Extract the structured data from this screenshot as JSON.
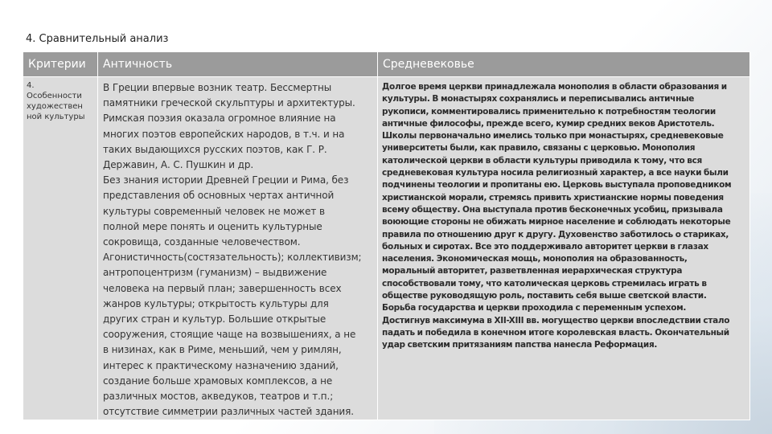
{
  "title": "4. Сравнительный анализ",
  "table": {
    "headers": [
      "Критерии",
      "Античность",
      "Средневековье"
    ],
    "criterion_lines": [
      "4.",
      "Особенности",
      "художествен",
      "ной культуры"
    ],
    "antiquity_lines": [
      "В Греции впервые возник театр. Бессмертны",
      "памятники греческой скульптуры и архитектуры.",
      "Римская поэзия оказала огромное влияние на",
      "многих поэтов европейских народов, в т.ч. и на",
      "таких выдающихся русских поэтов, как Г. Р.",
      "Державин, А. С. Пушкин и др.",
      "Без знания истории Древней Греции и Рима, без",
      "представления об основных чертах античной",
      "культуры современный человек не может в",
      "полной мере понять и оценить культурные",
      "сокровища, созданные человечеством.",
      "Агонистичность(состязательность); коллективизм;",
      "антропоцентризм (гуманизм) – выдвижение",
      "человека на первый план; завершенность всех",
      "жанров культуры; открытость культуры для",
      "других стран и культур. Большие открытые",
      "сооружения, стоящие чаще на возвышениях, а не",
      "в низинах, как в Риме, меньший, чем у римлян,",
      "интерес к практическому назначению зданий,",
      "создание больше храмовых комплексов, а не",
      "различных мостов, акведуков, театров и т.п.;",
      "отсутствие симметрии различных частей здания."
    ],
    "middle_ages_lines": [
      "Долгое время церкви принадлежала монополия в области образования и",
      "культуры. В монастырях сохранялись и переписывались античные",
      "рукописи, комментировались применительно к потребностям теологии",
      "античные философы, прежде всего, кумир средних веков Аристотель.",
      "Школы первоначально имелись только при монастырях, средневековые",
      "университеты были, как правило, связаны с церковью. Монополия",
      "католической церкви в области культуры приводила к тому, что вся",
      "средневековая культура носила религиозный характер, а все науки были",
      "подчинены теологии и пропитаны ею. Церковь выступала проповедником",
      "христианской морали, стремясь привить христианские нормы поведения",
      "всему обществу. Она выступала против бесконечных усобиц, призывала",
      "воюющие стороны не обижать мирное население и соблюдать некоторые",
      "правила по отношению друг к другу. Духовенство заботилось о стариках,",
      "больных и сиротах. Все это поддерживало авторитет церкви в глазах",
      "населения. Экономическая мощь, монополия на образованность,",
      "моральный авторитет, разветвленная иерархическая структура",
      "способствовали тому, что католическая церковь стремилась играть в",
      "обществе руководящую роль, поставить себя выше светской власти.",
      "Борьба государства и церкви проходила с переменным успехом.",
      "Достигнув максимума в XII-XIII вв. могущество церкви впоследствии стало",
      "падать и победила в конечном итоге королевская власть. Окончательный",
      "удар светским притязаниям папства нанесла Реформация."
    ]
  },
  "colors": {
    "header_bg": "#9b9b9b",
    "cell_bg": "#dcdcdc",
    "header_text": "#ffffff"
  }
}
